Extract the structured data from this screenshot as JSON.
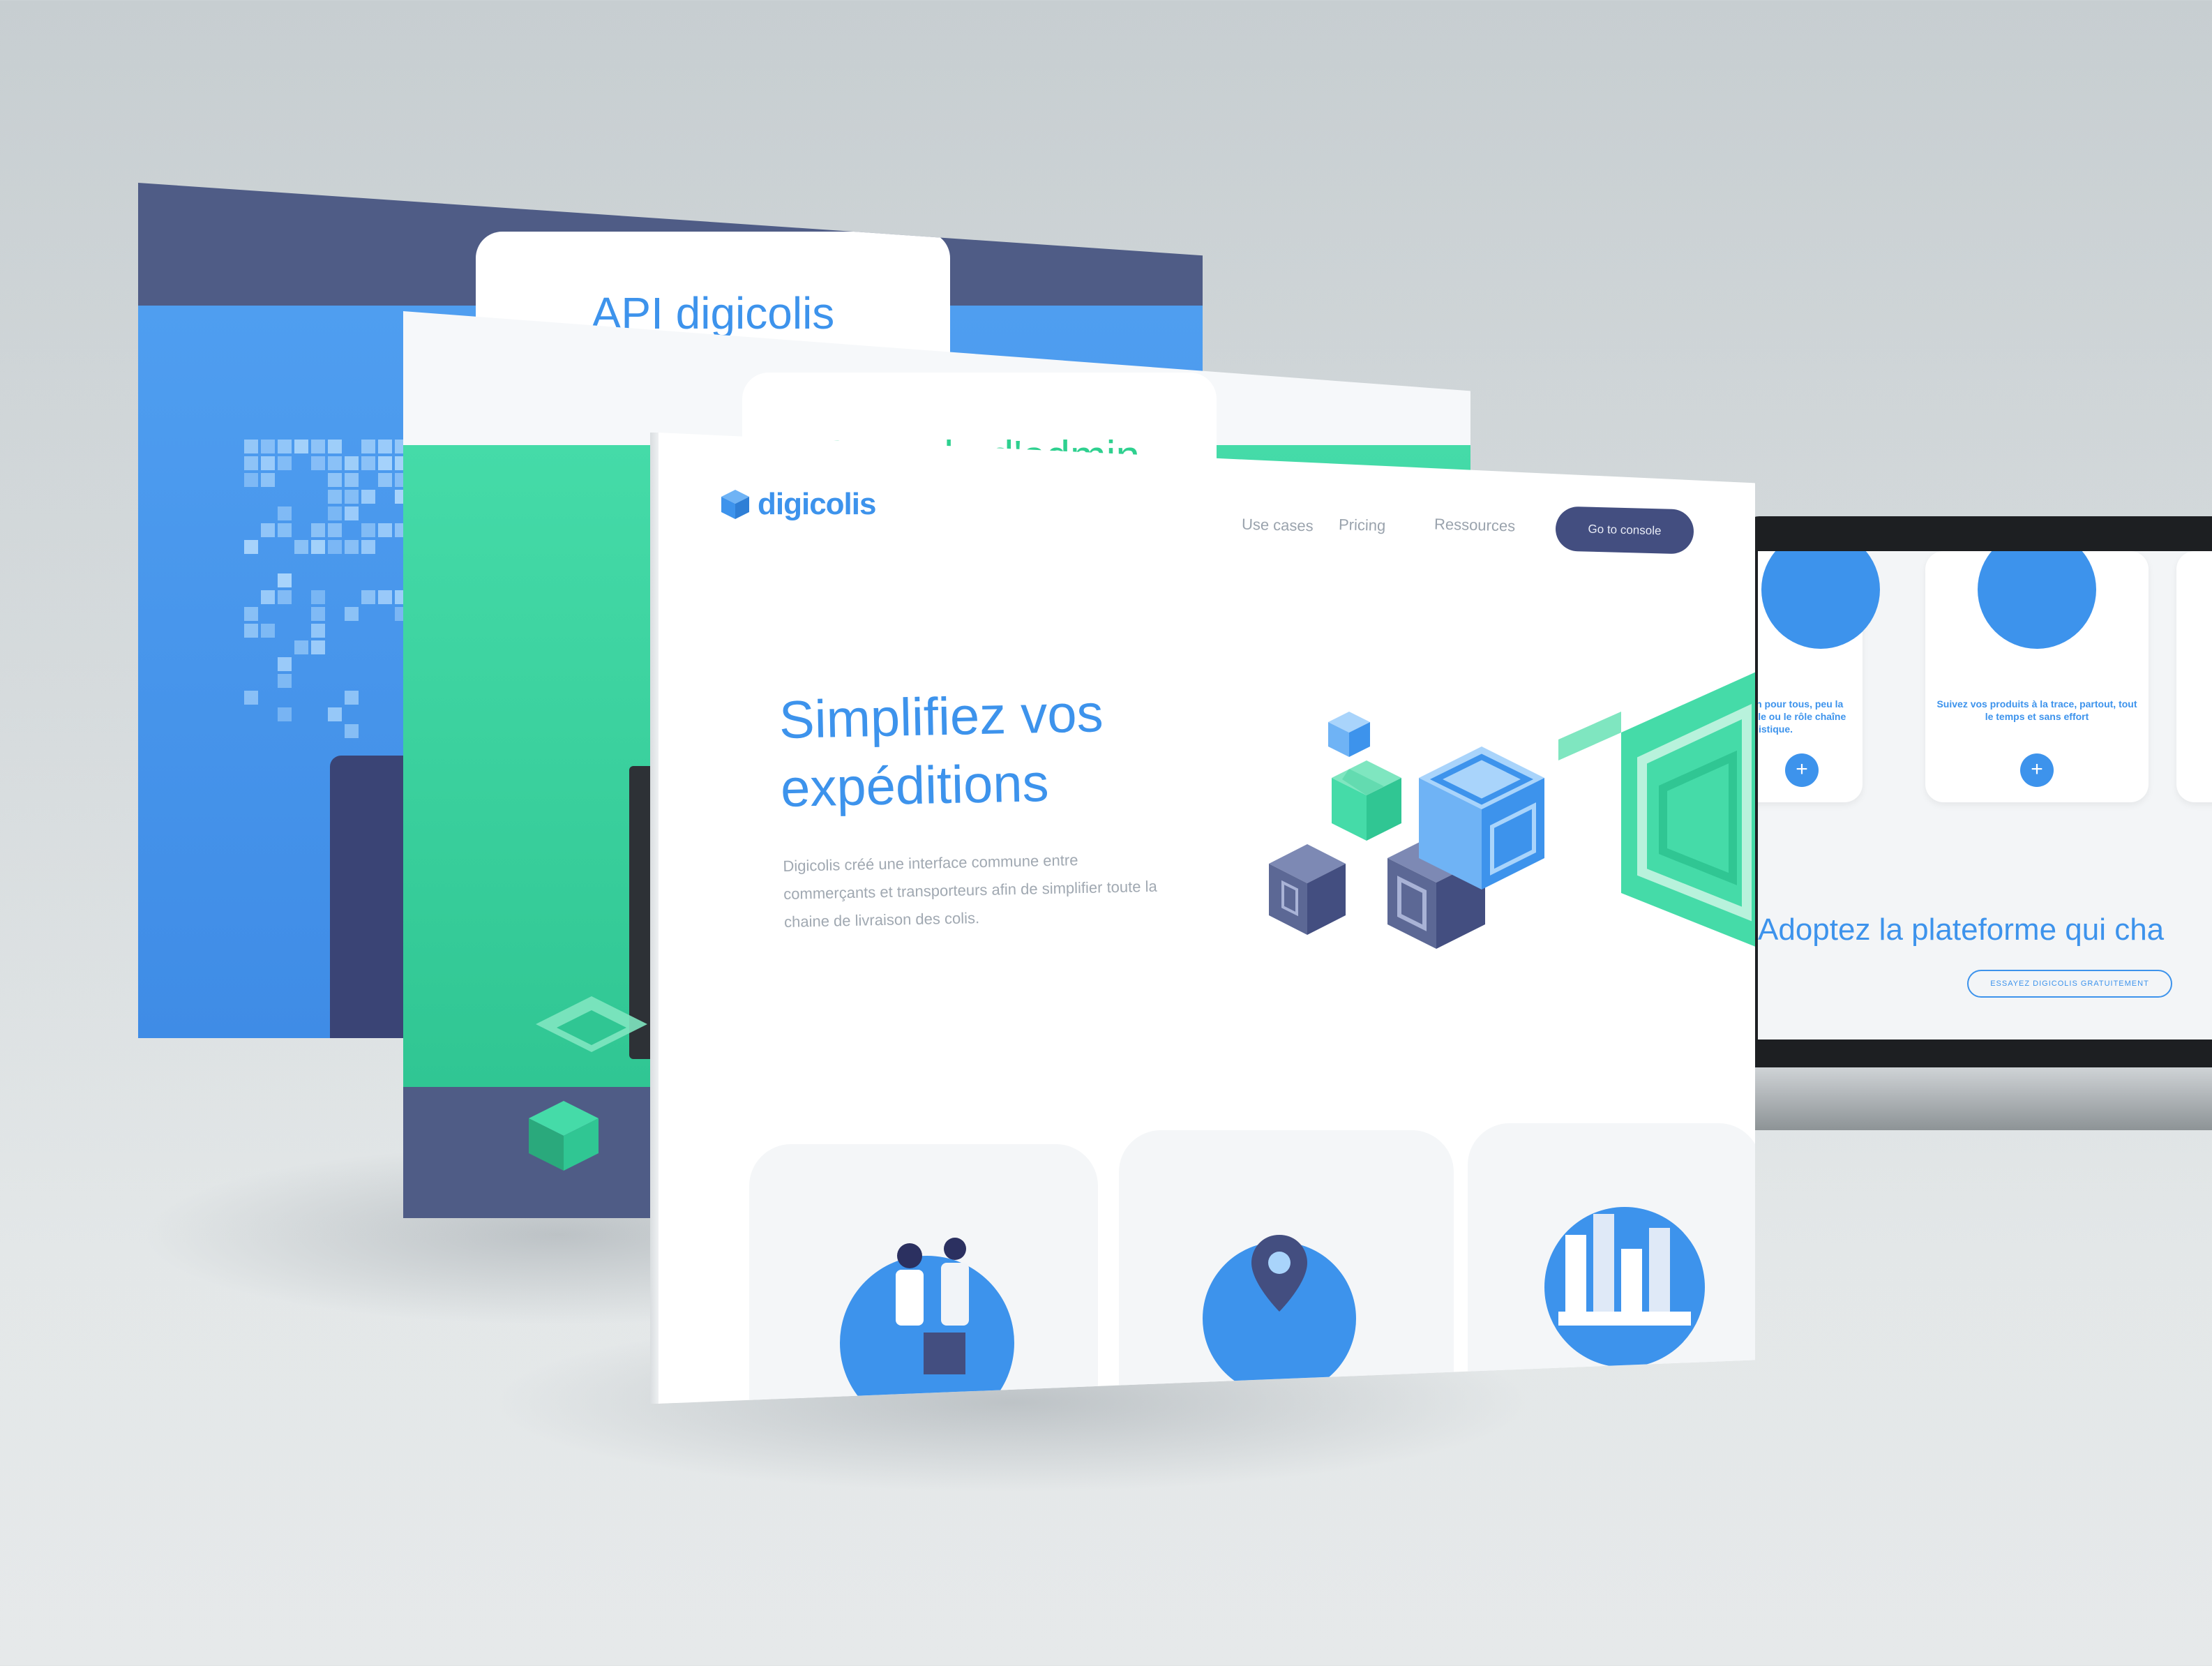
{
  "api_panel": {
    "title": "API digicolis"
  },
  "console_panel": {
    "title": "Console d'admin"
  },
  "landing": {
    "logo_text": "digicolis",
    "nav": [
      "Use cases",
      "Pricing",
      "Ressources"
    ],
    "cta_button": "Go to console",
    "hero_title_line1": "Simplifiez vos",
    "hero_title_line2": "expéditions",
    "hero_description": "Digicolis créé une interface commune entre commerçants et transporteurs afin de simplifier toute la chaine de livraison des colis."
  },
  "laptop_screen": {
    "card1_text": "tion pour tous, peu la taille ou le rôle chaîne logistique.",
    "card2_text": "Suivez vos produits à la trace, partout, tout le temps et sans effort",
    "plus_symbol": "+",
    "headline": "Adoptez la plateforme qui cha",
    "cta": "ESSAYEZ DIGICOLIS GRATUITEMENT"
  },
  "colors": {
    "brand_blue": "#3d93ec",
    "navy": "#434e80",
    "green": "#30c693",
    "background": "#d7dcde"
  },
  "icons": [
    "box-logo-icon",
    "plus-icon"
  ]
}
